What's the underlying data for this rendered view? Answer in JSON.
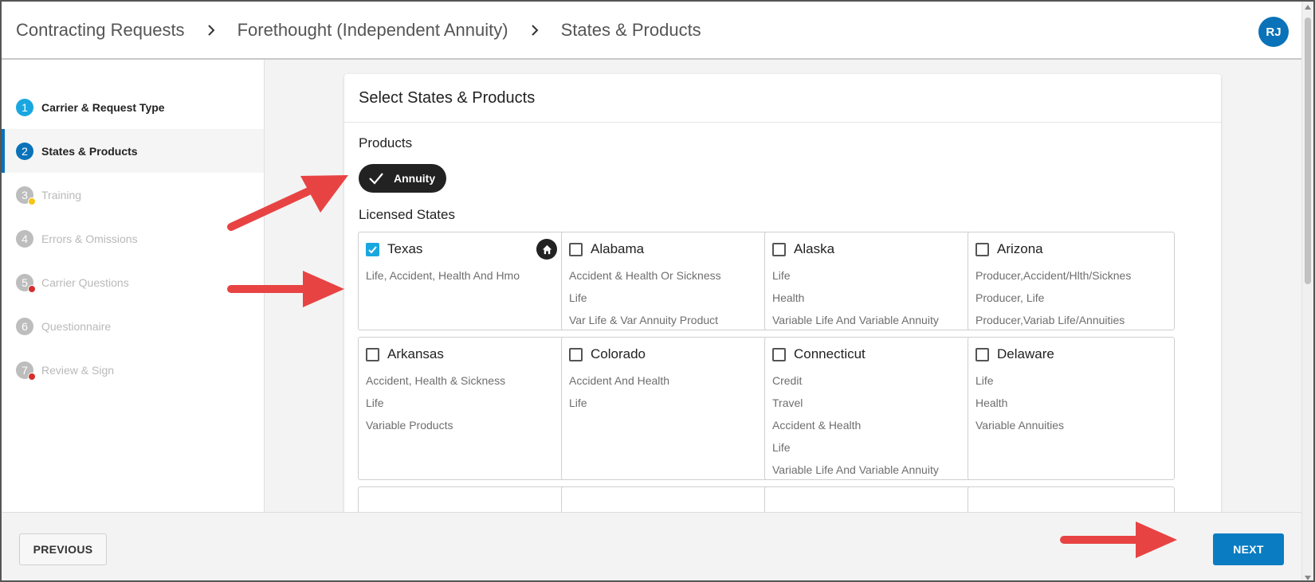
{
  "breadcrumb": [
    "Contracting Requests",
    "Forethought (Independent Annuity)",
    "States & Products"
  ],
  "user": {
    "initials": "RJ"
  },
  "steps": [
    {
      "num": "1",
      "label": "Carrier & Request Type"
    },
    {
      "num": "2",
      "label": "States & Products"
    },
    {
      "num": "3",
      "label": "Training"
    },
    {
      "num": "4",
      "label": "Errors & Omissions"
    },
    {
      "num": "5",
      "label": "Carrier Questions"
    },
    {
      "num": "6",
      "label": "Questionnaire"
    },
    {
      "num": "7",
      "label": "Review & Sign"
    }
  ],
  "card": {
    "title": "Select States & Products",
    "products_label": "Products",
    "product_chip": "Annuity",
    "states_label": "Licensed States"
  },
  "states": [
    {
      "name": "Texas",
      "checked": true,
      "home": true,
      "licenses": [
        "Life, Accident, Health And Hmo"
      ]
    },
    {
      "name": "Alabama",
      "checked": false,
      "licenses": [
        "Accident & Health Or Sickness",
        "Life",
        "Var Life & Var Annuity Product"
      ]
    },
    {
      "name": "Alaska",
      "checked": false,
      "licenses": [
        "Life",
        "Health",
        "Variable Life And Variable Annuity"
      ]
    },
    {
      "name": "Arizona",
      "checked": false,
      "licenses": [
        "Producer,Accident/Hlth/Sicknes",
        "Producer, Life",
        "Producer,Variab Life/Annuities"
      ]
    },
    {
      "name": "Arkansas",
      "checked": false,
      "licenses": [
        "Accident, Health & Sickness",
        "Life",
        "Variable Products"
      ]
    },
    {
      "name": "Colorado",
      "checked": false,
      "licenses": [
        "Accident And Health",
        "Life"
      ]
    },
    {
      "name": "Connecticut",
      "checked": false,
      "licenses": [
        "Credit",
        "Travel",
        "Accident & Health",
        "Life",
        "Variable Life And Variable Annuity"
      ]
    },
    {
      "name": "Delaware",
      "checked": false,
      "licenses": [
        "Life",
        "Health",
        "Variable Annuities"
      ]
    }
  ],
  "footer": {
    "previous_label": "PREVIOUS",
    "next_label": "NEXT"
  },
  "colors": {
    "accent": "#0a72b8",
    "step_done": "#1aa7e0",
    "checkbox_checked": "#1aa7e0",
    "arrow": "#e84343",
    "warning_dot": "#f5c518",
    "error_dot": "#d32f2f"
  }
}
